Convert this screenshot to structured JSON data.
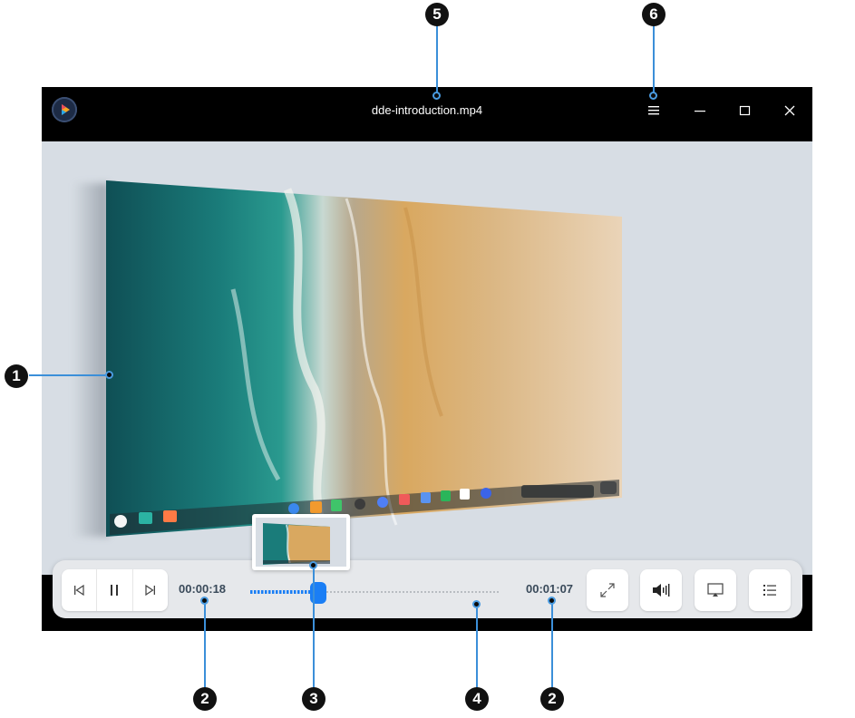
{
  "window": {
    "title": "dde-introduction.mp4",
    "app_icon": "movie-app-icon",
    "buttons": [
      "menu-icon",
      "minimize-icon",
      "maximize-icon",
      "close-icon"
    ]
  },
  "playback": {
    "current_time": "00:00:18",
    "total_time": "00:01:07",
    "progress_fraction": 0.27
  },
  "controls": {
    "left_group": [
      "previous-icon",
      "pause-icon",
      "next-icon"
    ],
    "right_buttons": [
      "fullscreen-icon",
      "volume-icon",
      "screencast-icon",
      "playlist-icon"
    ]
  },
  "callouts": {
    "c1": "1",
    "c2a": "2",
    "c2b": "2",
    "c3": "3",
    "c4": "4",
    "c5": "5",
    "c6": "6"
  },
  "colors": {
    "accent": "#1a7ef5",
    "callout_line": "#3b8fd9",
    "titlebar": "#000000",
    "video_bg": "#d7dde4"
  }
}
